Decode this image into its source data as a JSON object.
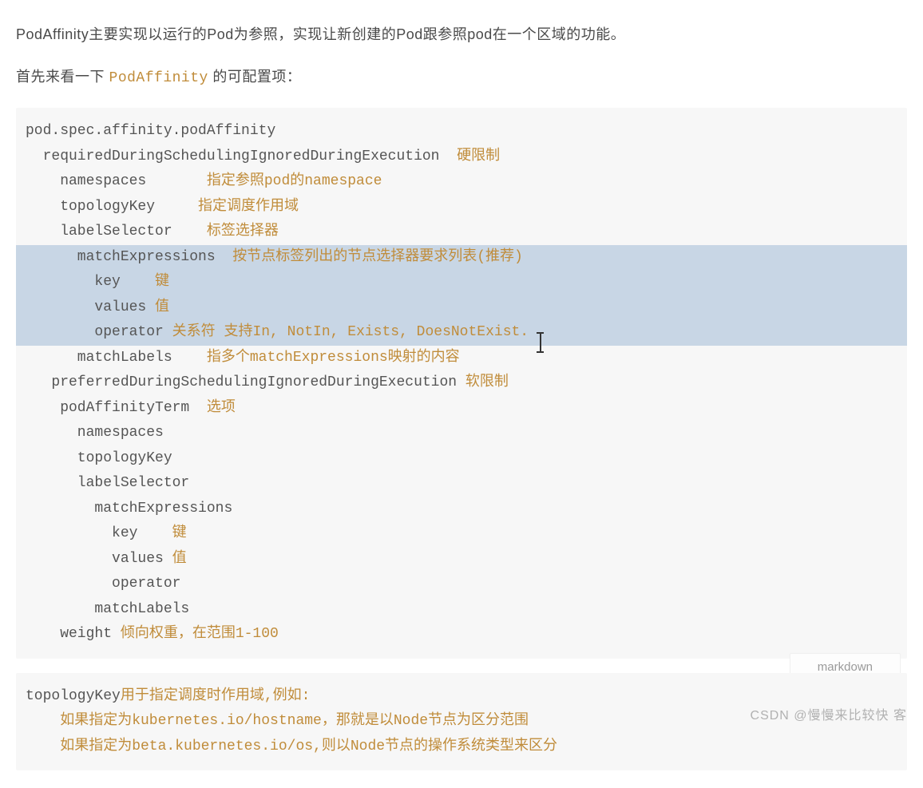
{
  "intro": {
    "p1": "PodAffinity主要实现以运行的Pod为参照，实现让新创建的Pod跟参照pod在一个区域的功能。",
    "p2_pre": "首先来看一下 ",
    "p2_code": "PodAffinity",
    "p2_post": " 的可配置项："
  },
  "block1": {
    "l1": "pod.spec.affinity.podAffinity",
    "l2_code": "  requiredDuringSchedulingIgnoredDuringExecution  ",
    "l2_c": "硬限制",
    "l3_code": "    namespaces       ",
    "l3_c": "指定参照pod的namespace",
    "l4_code": "    topologyKey     ",
    "l4_c": "指定调度作用域",
    "l5_code": "    labelSelector    ",
    "l5_c": "标签选择器",
    "h1_code": "      matchExpressions  ",
    "h1_c": "按节点标签列出的节点选择器要求列表(推荐)",
    "h2_code": "        key    ",
    "h2_c": "键",
    "h3_code": "        values ",
    "h3_c": "值",
    "h4_code": "        operator ",
    "h4_c": "关系符 支持In, NotIn, Exists, DoesNotExist.",
    "l10_code": "      matchLabels    ",
    "l10_c": "指多个matchExpressions映射的内容",
    "l11_code": "   preferredDuringSchedulingIgnoredDuringExecution ",
    "l11_c": "软限制",
    "l12_code": "    podAffinityTerm  ",
    "l12_c": "选项",
    "l13": "      namespaces",
    "l14": "      topologyKey",
    "l15": "      labelSelector",
    "l16": "        matchExpressions",
    "l17_code": "          key    ",
    "l17_c": "键",
    "l18_code": "          values ",
    "l18_c": "值",
    "l19": "          operator",
    "l20": "        matchLabels",
    "l21_code": "    weight ",
    "l21_c": "倾向权重，在范围1-100",
    "lang": "markdown"
  },
  "block2": {
    "l1_code": "topologyKey",
    "l1_c": "用于指定调度时作用域,例如:",
    "l2": "    如果指定为kubernetes.io/hostname，那就是以Node节点为区分范围",
    "l3": "    如果指定为beta.kubernetes.io/os,则以Node节点的操作系统类型来区分"
  },
  "watermark": "CSDN @慢慢来比较快 客"
}
